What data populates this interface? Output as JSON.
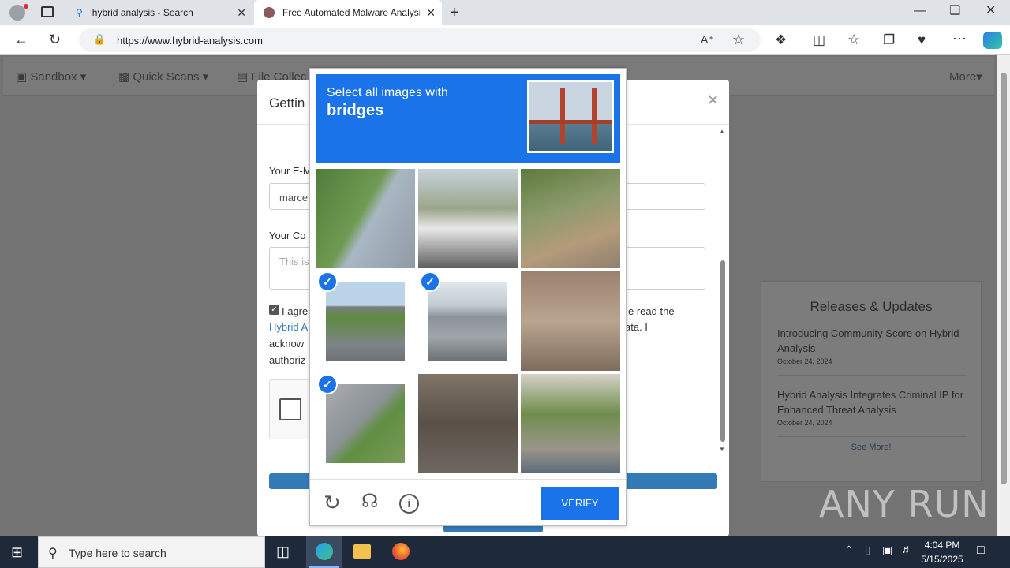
{
  "browser": {
    "tabs": [
      {
        "label": "hybrid analysis - Search"
      },
      {
        "label": "Free Automated Malware Analysis"
      }
    ],
    "url": "https://www.hybrid-analysis.com"
  },
  "nav": {
    "items": [
      "Sandbox",
      "Quick Scans",
      "File Collec"
    ],
    "more": "More"
  },
  "modal": {
    "title": "Gettin",
    "email_label": "Your E-M",
    "email_value": "marce",
    "comment_label": "Your Co",
    "comment_placeholder": "This is",
    "agree_line1_left": "I agre",
    "agree_line1_right": "e read the",
    "agree_link": "Hybrid A",
    "agree_line2_right": "ata. I",
    "agree_line3": "acknow",
    "agree_line4": "authoriz"
  },
  "captcha": {
    "prompt": "Select all images with",
    "target": "bridges",
    "verify": "VERIFY",
    "selected": [
      3,
      4,
      6
    ]
  },
  "releases": {
    "title": "Releases & Updates",
    "items": [
      {
        "title": "Introducing Community Score on Hybrid Analysis",
        "date": "October 24, 2024"
      },
      {
        "title": "Hybrid Analysis Integrates Criminal IP for Enhanced Threat Analysis",
        "date": "October 24, 2024"
      }
    ],
    "see_more": "See More!"
  },
  "watermark": "ANY RUN",
  "taskbar": {
    "search_placeholder": "Type here to search",
    "time": "4:04 PM",
    "date": "5/15/2025"
  }
}
